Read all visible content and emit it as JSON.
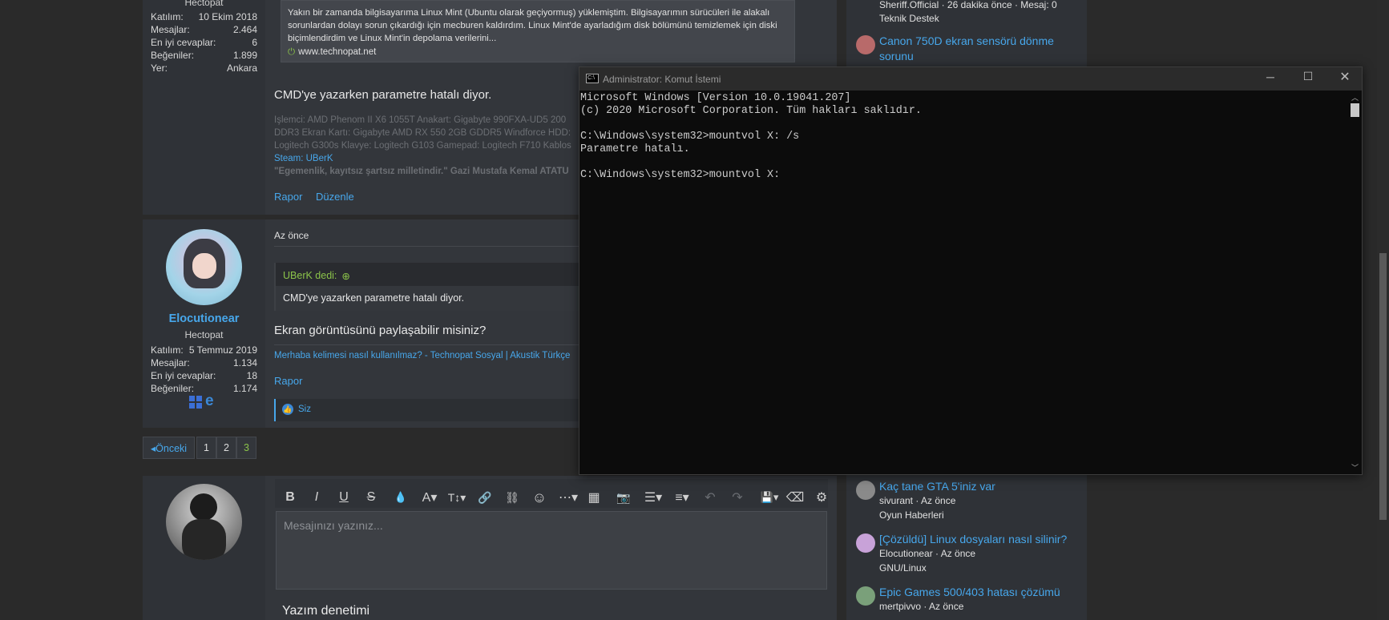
{
  "user1": {
    "role": "Hectopat",
    "rows": [
      [
        "Katılım:",
        "10 Ekim 2018"
      ],
      [
        "Mesajlar:",
        "2.464"
      ],
      [
        "En iyi cevaplar:",
        "6"
      ],
      [
        "Beğeniler:",
        "1.899"
      ],
      [
        "Yer:",
        "Ankara"
      ]
    ]
  },
  "post1": {
    "preview": "Yakın bir zamanda bilgisayarıma Linux Mint (Ubuntu olarak geçiyormuş) yüklemiştim. Bilgisayarımın sürücüleri ile alakalı sorunlardan dolayı sorun çıkardığı için mecburen kaldırdım. Linux Mint'de ayarladığım disk bölümünü temizlemek için diski biçimlendirdim ve Linux Mint'in depolama verilerini...",
    "preview_site": "www.technopat.net",
    "body": "CMD'ye yazarken parametre hatalı diyor.",
    "sig1": "İşlemci: AMD Phenom II X6 1055T Anakart: Gigabyte 990FXA-UD5 200",
    "sig2": "DDR3 Ekran Kartı: Gigabyte AMD RX 550 2GB GDDR5 Windforce HDD:",
    "sig3": "Logitech G300s Klavye: Logitech G103 Gamepad: Logitech F710 Kablos",
    "steam": "Steam: UBerK",
    "quote": "\"Egemenlik, kayıtsız şartsız milletindir.\" Gazi Mustafa Kemal ATATÜ",
    "report": "Rapor",
    "edit": "Düzenle"
  },
  "user2": {
    "name": "Elocutionear",
    "role": "Hectopat",
    "rows": [
      [
        "Katılım:",
        "5 Temmuz 2019"
      ],
      [
        "Mesajlar:",
        "1.134"
      ],
      [
        "En iyi cevaplar:",
        "18"
      ],
      [
        "Beğeniler:",
        "1.174"
      ]
    ]
  },
  "post2": {
    "time": "Az önce",
    "quote_author": "UBerK dedi:",
    "quote_text": "CMD'ye yazarken parametre hatalı diyor.",
    "body": "Ekran görüntüsünü paylaşabilir misiniz?",
    "sig": "Merhaba kelimesi nasıl kullanılmaz? - Technopat Sosyal | Akustik Türkçe",
    "report": "Rapor",
    "likes": "Siz"
  },
  "pager": {
    "prev": "◂Önceki",
    "pages": [
      "1",
      "2",
      "3"
    ]
  },
  "editor": {
    "placeholder": "Mesajınızı yazınız...",
    "spell": "Yazım denetimi",
    "tools": [
      "B",
      "I",
      "U",
      "S",
      "💧",
      "A▾",
      "T↕▾",
      "🔗",
      "⛓",
      "☺",
      "⋯▾",
      "▦",
      "📷",
      "☰▾",
      "≡▾",
      "↶",
      "↷",
      "💾▾",
      "⌫",
      "⚙"
    ]
  },
  "sidebar": {
    "items": [
      {
        "title": "",
        "meta": "Sheriff.Official · 26 dakika önce · Mesaj: 0",
        "sub": "Teknik Destek"
      },
      {
        "title": "Canon 750D ekran sensörü dönme sorunu",
        "meta": "",
        "sub": ""
      },
      {
        "title": "Kaç tane GTA 5'iniz var",
        "meta": "sivurant · Az önce",
        "sub": "Oyun Haberleri"
      },
      {
        "title": "[Çözüldü] Linux dosyaları nasıl silinir?",
        "meta": "Elocutionear · Az önce",
        "sub": "GNU/Linux"
      },
      {
        "title": "Epic Games 500/403 hatası çözümü",
        "meta": "mertpivvo · Az önce",
        "sub": ""
      }
    ]
  },
  "cmd": {
    "title": "Administrator: Komut İstemi",
    "lines": [
      "Microsoft Windows [Version 10.0.19041.207]",
      "(c) 2020 Microsoft Corporation. Tüm hakları saklıdır.",
      "",
      "C:\\Windows\\system32>mountvol X: /s",
      "Parametre hatalı.",
      "",
      "C:\\Windows\\system32>mountvol X:"
    ]
  },
  "colors": {
    "accent": "#47a7eb",
    "green": "#8bc34a",
    "cmd_bg": "#0c0c0c"
  }
}
